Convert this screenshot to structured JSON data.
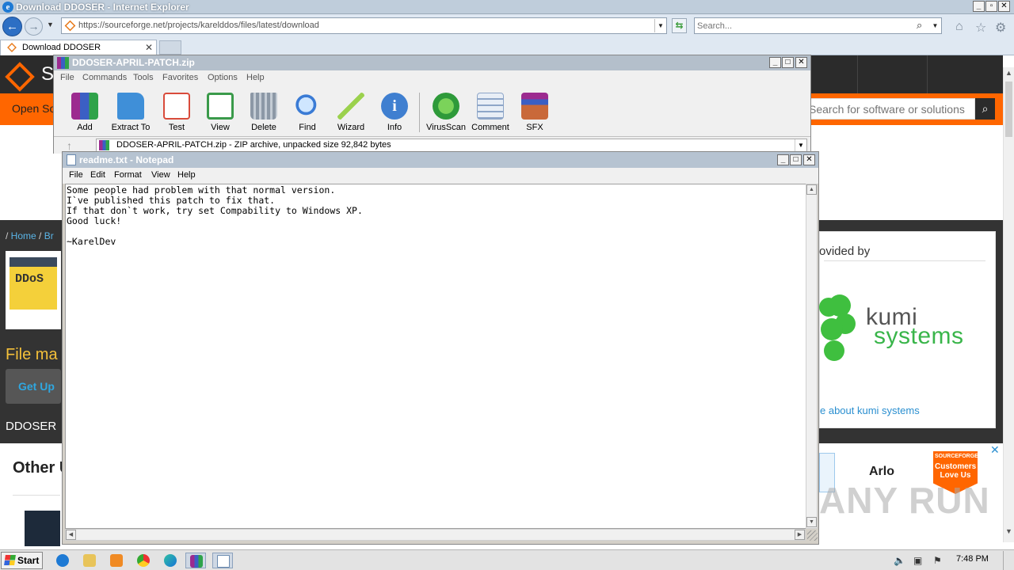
{
  "browser": {
    "window_title": "Download DDOSER - Internet Explorer",
    "address": "https://sourceforge.net/projects/karelddos/files/latest/download",
    "search_placeholder": "Search...",
    "tabs": [
      {
        "label": "Download DDOSER",
        "active": true
      }
    ]
  },
  "sourceforge": {
    "logo_letter": "S",
    "open_source_text": "Open So",
    "search_placeholder": "Search for software or solutions",
    "breadcrumb": [
      "Home",
      "Br"
    ],
    "project_icon_text": "DDoS",
    "file_heading": "File ma",
    "getup_label": "Get Up",
    "project_name": "DDOSER",
    "other_heading": "Other U",
    "ad_provided_by": "ovided by",
    "ad_brand_line1": "kumi",
    "ad_brand_line2": "systems",
    "ad_link": "e about kumi systems",
    "banner_brand": "Arlo",
    "badge_top": "SOURCEFORGE",
    "badge_mid": "Customers Love Us",
    "watermark": "ANY RUN"
  },
  "winrar": {
    "title": "DDOSER-APRIL-PATCH.zip",
    "menu": [
      "File",
      "Commands",
      "Tools",
      "Favorites",
      "Options",
      "Help"
    ],
    "tools": [
      {
        "label": "Add",
        "color": "#b0487a"
      },
      {
        "label": "Extract To",
        "color": "#3f8fd8"
      },
      {
        "label": "Test",
        "color": "#d94b3b"
      },
      {
        "label": "View",
        "color": "#3a9a4a"
      },
      {
        "label": "Delete",
        "color": "#8c98a6"
      },
      {
        "label": "Find",
        "color": "#3a7bd5"
      },
      {
        "label": "Wizard",
        "color": "#9bd14d"
      },
      {
        "label": "Info",
        "color": "#3f7fd0"
      },
      {
        "label": "VirusScan",
        "color": "#2e9a3a"
      },
      {
        "label": "Comment",
        "color": "#8ea6c8"
      },
      {
        "label": "SFX",
        "color": "#c9693a"
      }
    ],
    "path_text": "DDOSER-APRIL-PATCH.zip - ZIP archive, unpacked size 92,842 bytes"
  },
  "notepad": {
    "title": "readme.txt - Notepad",
    "menu": [
      "File",
      "Edit",
      "Format",
      "View",
      "Help"
    ],
    "content": "Some people had problem with that normal version.\nI`ve published this patch to fix that.\nIf that don`t work, try set Compability to Windows XP.\nGood luck!\n\n~KarelDev"
  },
  "taskbar": {
    "start_label": "Start",
    "clock": "7:48 PM"
  }
}
